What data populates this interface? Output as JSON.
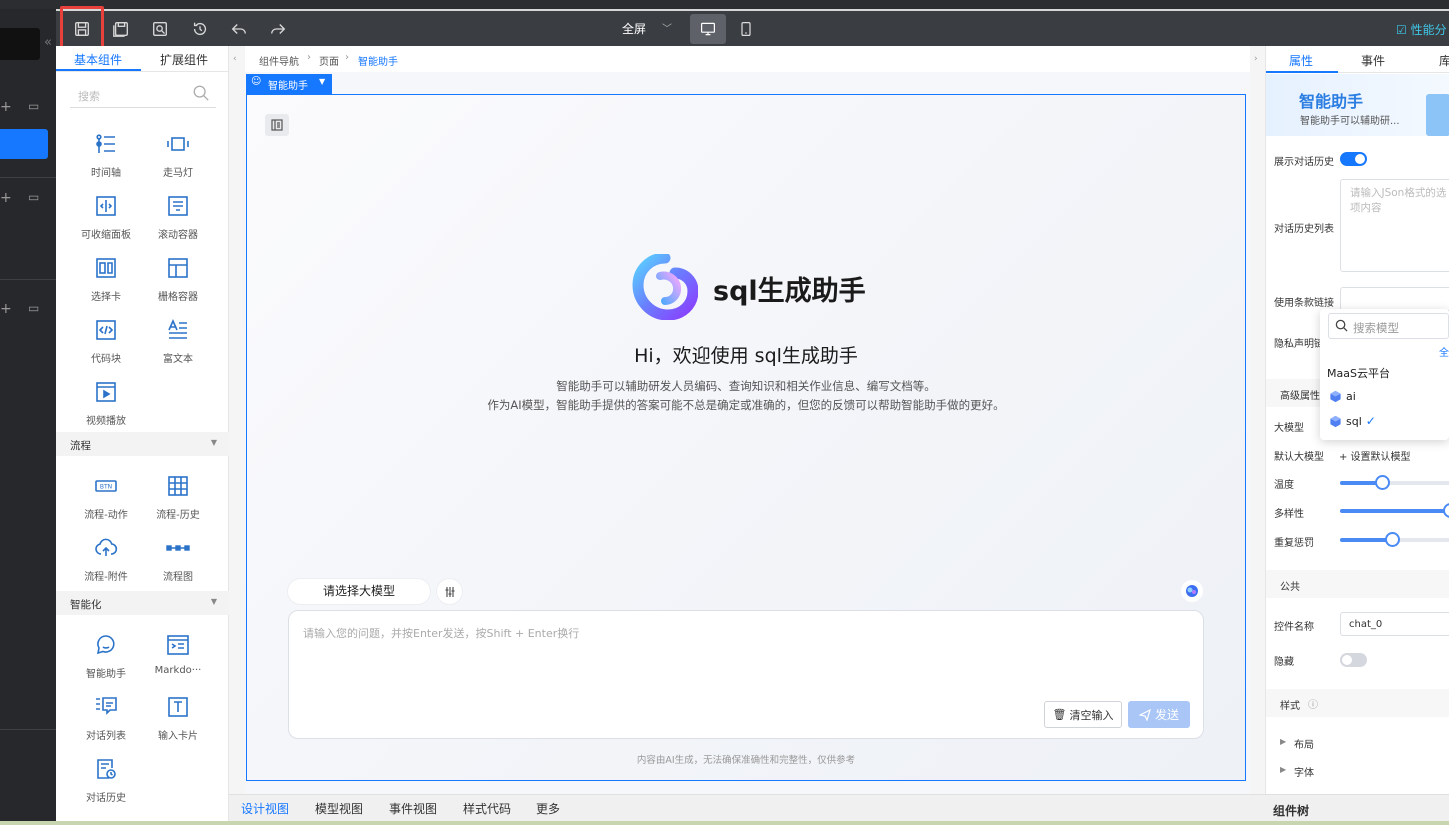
{
  "toolbar": {
    "fullscreen_label": "全屏",
    "performance_label": "性能分",
    "icons": [
      "save-icon",
      "save-as-icon",
      "preview-icon",
      "history-icon",
      "undo-icon",
      "redo-icon",
      "chevron-down-icon",
      "desktop-icon",
      "mobile-icon",
      "checkbox-icon"
    ]
  },
  "component_panel": {
    "tabs": [
      {
        "label": "基本组件"
      },
      {
        "label": "扩展组件"
      }
    ],
    "search_placeholder": "搜索",
    "basic_items": [
      {
        "label": "时间轴",
        "icon": "timeline-icon"
      },
      {
        "label": "走马灯",
        "icon": "carousel-icon"
      },
      {
        "label": "可收缩面板",
        "icon": "collapse-panel-icon"
      },
      {
        "label": "滚动容器",
        "icon": "scroll-container-icon"
      },
      {
        "label": "选择卡",
        "icon": "tabs-icon"
      },
      {
        "label": "栅格容器",
        "icon": "grid-container-icon"
      },
      {
        "label": "代码块",
        "icon": "code-block-icon"
      },
      {
        "label": "富文本",
        "icon": "rich-text-icon"
      },
      {
        "label": "视频播放",
        "icon": "video-icon"
      }
    ],
    "sections": [
      {
        "title": "流程",
        "items": [
          {
            "label": "流程-动作",
            "icon": "btn-icon"
          },
          {
            "label": "流程-历史",
            "icon": "table-icon"
          },
          {
            "label": "流程-附件",
            "icon": "cloud-upload-icon"
          },
          {
            "label": "流程图",
            "icon": "flow-chart-icon"
          }
        ]
      },
      {
        "title": "智能化",
        "items": [
          {
            "label": "智能助手",
            "icon": "chat-bubble-icon"
          },
          {
            "label": "Markdo···",
            "icon": "markdown-icon"
          },
          {
            "label": "对话列表",
            "icon": "chat-list-icon"
          },
          {
            "label": "输入卡片",
            "icon": "input-card-icon"
          },
          {
            "label": "对话历史",
            "icon": "chat-history-icon"
          }
        ]
      }
    ]
  },
  "breadcrumb": [
    "组件导航",
    "页面",
    "智能助手"
  ],
  "canvas": {
    "component_tag": "智能助手",
    "app_title": "sql生成助手",
    "greeting": "Hi，欢迎使用 sql生成助手",
    "desc_line1": "智能助手可以辅助研发人员编码、查询知识和相关作业信息、编写文档等。",
    "desc_line2": "作为AI模型，智能助手提供的答案可能不总是确定或准确的，但您的反馈可以帮助智能助手做的更好。",
    "model_pill": "请选择大模型",
    "input_placeholder": "请输入您的问题，并按Enter发送，按Shift + Enter换行",
    "clear_label": "清空输入",
    "send_label": "发送",
    "footnote": "内容由AI生成，无法确保准确性和完整性，仅供参考"
  },
  "bottom_tabs": [
    {
      "label": "设计视图"
    },
    {
      "label": "模型视图"
    },
    {
      "label": "事件视图"
    },
    {
      "label": "样式代码"
    },
    {
      "label": "更多"
    }
  ],
  "right_panel": {
    "tabs": [
      {
        "label": "属性"
      },
      {
        "label": "事件"
      },
      {
        "label": "库"
      }
    ],
    "comp_name": "智能助手",
    "comp_desc": "智能助手可以辅助研...",
    "show_history_label": "展示对话历史",
    "show_history_on": true,
    "history_list_label": "对话历史列表",
    "history_list_placeholder": "请输入JSon格式的选项内容",
    "terms_label": "使用条款链接",
    "privacy_label": "隐私声明链",
    "advanced_label": "高级属性",
    "llm_label": "大模型",
    "default_llm_label": "默认大模型",
    "set_default_label": "+ 设置默认模型",
    "temperature_label": "温度",
    "temperature_value": 0.38,
    "diversity_label": "多样性",
    "diversity_value": 1.0,
    "penalty_label": "重复惩罚",
    "penalty_value": 0.47,
    "public_label": "公共",
    "control_name_label": "控件名称",
    "control_name_value": "chat_0",
    "hidden_label": "隐藏",
    "hidden_on": false,
    "style_label": "样式",
    "layout_label": "布局",
    "font_label": "字体",
    "tree_label": "组件树"
  },
  "model_dropdown": {
    "search_placeholder": "搜索模型",
    "all_label": "全",
    "group": "MaaS云平台",
    "items": [
      {
        "label": "ai",
        "selected": false
      },
      {
        "label": "sql",
        "selected": true
      }
    ]
  },
  "colors": {
    "accent": "#1677ff",
    "toolbar": "#3a3d42",
    "highlight": "#e8413c"
  }
}
